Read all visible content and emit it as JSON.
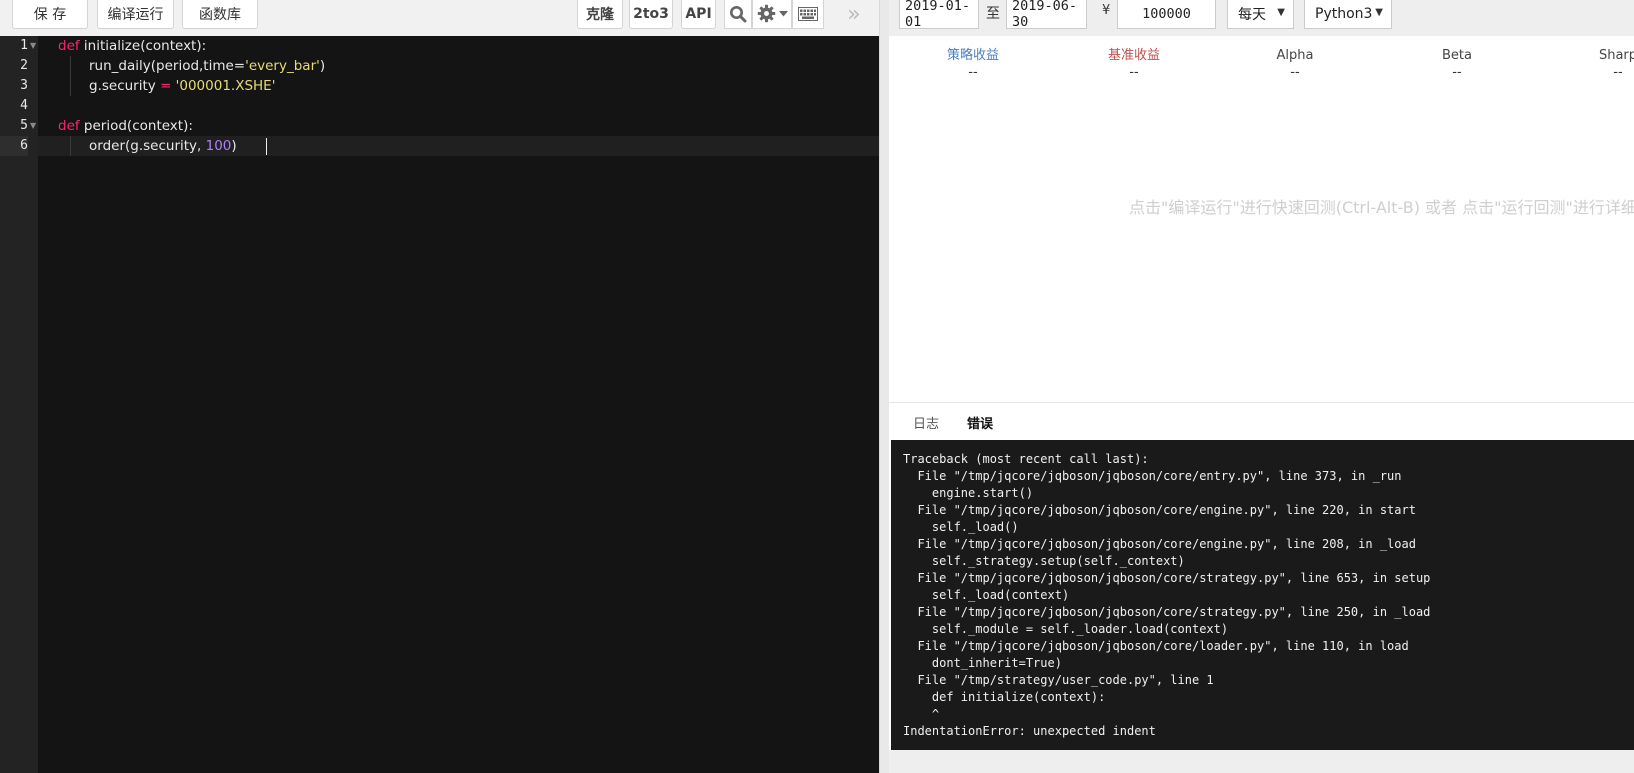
{
  "toolbar": {
    "save_label": "保 存",
    "compile_label": "编译运行",
    "library_label": "函数库",
    "clone_label": "克隆",
    "twoto3_label": "2to3",
    "api_label": "API"
  },
  "editor": {
    "line_numbers": [
      "1",
      "2",
      "3",
      "4",
      "5",
      "6"
    ],
    "lines": {
      "l1": {
        "kw": "def",
        "rest": " initialize(context):"
      },
      "l2": {
        "pre": "run_daily(period,time=",
        "str": "'every_bar'",
        "post": ")"
      },
      "l3": {
        "pre": "g.security ",
        "op": "=",
        "str": " '000001.XSHE'"
      },
      "l5": {
        "kw": "def",
        "rest": " period(context):"
      },
      "l6": {
        "pre": "order(g.security, ",
        "num": "100",
        "post": ")"
      }
    }
  },
  "params": {
    "start_date": "2019-01-01",
    "to_label": "至",
    "end_date": "2019-06-30",
    "currency_symbol": "¥",
    "capital": "100000",
    "frequency": "每天",
    "python_version": "Python3"
  },
  "metrics": [
    {
      "label": "策略收益",
      "value": "--",
      "color": "#4a7fc1"
    },
    {
      "label": "基准收益",
      "value": "--",
      "color": "#c0504d"
    },
    {
      "label": "Alpha",
      "value": "--",
      "color": "#444444"
    },
    {
      "label": "Beta",
      "value": "--",
      "color": "#444444"
    },
    {
      "label": "Sharp",
      "value": "--",
      "color": "#444444"
    }
  ],
  "hint": "点击\"编译运行\"进行快速回测(Ctrl-Alt-B) 或者 点击\"运行回测\"进行详细",
  "tabs": {
    "log": "日志",
    "error": "错误"
  },
  "error_log": [
    "Traceback (most recent call last):",
    "  File \"/tmp/jqcore/jqboson/jqboson/core/entry.py\", line 373, in _run",
    "    engine.start()",
    "  File \"/tmp/jqcore/jqboson/jqboson/core/engine.py\", line 220, in start",
    "    self._load()",
    "  File \"/tmp/jqcore/jqboson/jqboson/core/engine.py\", line 208, in _load",
    "    self._strategy.setup(self._context)",
    "  File \"/tmp/jqcore/jqboson/jqboson/core/strategy.py\", line 653, in setup",
    "    self._load(context)",
    "  File \"/tmp/jqcore/jqboson/jqboson/core/strategy.py\", line 250, in _load",
    "    self._module = self._loader.load(context)",
    "  File \"/tmp/jqcore/jqboson/jqboson/core/loader.py\", line 110, in load",
    "    dont_inherit=True)",
    "  File \"/tmp/strategy/user_code.py\", line 1",
    "    def initialize(context):",
    "    ^",
    "IndentationError: unexpected indent"
  ],
  "icons": [
    "search-icon",
    "gear-icon",
    "chevron-down-icon",
    "keyboard-icon",
    "double-chevron-right-icon",
    "caret-down-icon"
  ],
  "colors": {
    "keyword": "#f5286c",
    "string": "#e6db74",
    "number": "#ae81ff",
    "editor_bg": "#141414",
    "log_bg": "#1a1a1a"
  }
}
